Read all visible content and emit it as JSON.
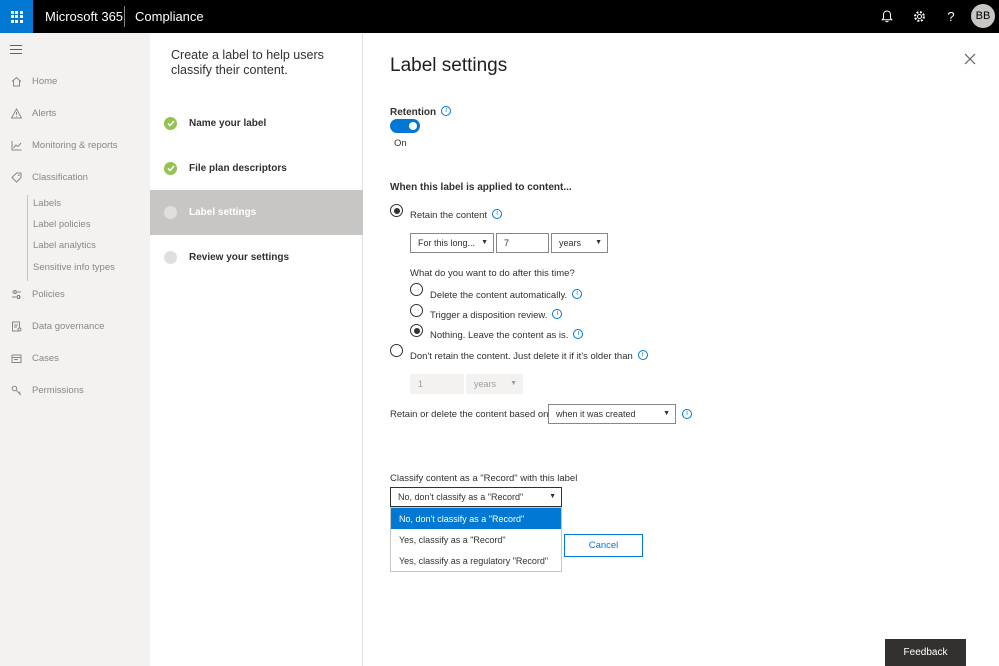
{
  "topbar": {
    "brand": "Microsoft 365",
    "app": "Compliance",
    "avatar": "BB",
    "icons": [
      "bell-icon",
      "gear-icon",
      "help-icon"
    ]
  },
  "nav": {
    "items": [
      {
        "label": "Home",
        "icon": "home-icon"
      },
      {
        "label": "Alerts",
        "icon": "alert-icon"
      },
      {
        "label": "Monitoring & reports",
        "icon": "chart-icon"
      },
      {
        "label": "Classification",
        "icon": "tag-icon"
      },
      {
        "label": "Policies",
        "icon": "sliders-icon"
      },
      {
        "label": "Data governance",
        "icon": "lock-icon"
      },
      {
        "label": "Cases",
        "icon": "cases-icon"
      },
      {
        "label": "Permissions",
        "icon": "key-icon"
      }
    ],
    "subitems": [
      "Labels",
      "Label policies",
      "Label analytics",
      "Sensitive info types"
    ]
  },
  "wizard": {
    "heading": "Create a label to help users classify their content.",
    "steps": [
      "Name your label",
      "File plan descriptors",
      "Label settings",
      "Review your settings"
    ]
  },
  "main": {
    "title": "Label settings",
    "retention_label": "Retention",
    "toggle_state": "On",
    "section_heading": "When this label is applied to content...",
    "retain_label": "Retain the content",
    "retain_period": "For this long...",
    "retain_value": "7",
    "retain_unit": "years",
    "after_question": "What do you want to do after this time?",
    "opt_delete": "Delete the content automatically.",
    "opt_disposition": "Trigger a disposition review.",
    "opt_nothing": "Nothing. Leave the content as is.",
    "dont_retain_label": "Don't retain the content. Just delete it if it's older than",
    "dont_retain_value": "1",
    "dont_retain_unit": "years",
    "based_on_label": "Retain or delete the content based on",
    "based_on_value": "when it was created",
    "record_label": "Classify content as a \"Record\" with this label",
    "record_value": "No, don't classify as a \"Record\"",
    "record_options": [
      "No, don't classify as a \"Record\"",
      "Yes, classify as a \"Record\"",
      "Yes, classify as a regulatory \"Record\""
    ],
    "cancel": "Cancel",
    "feedback": "Feedback"
  },
  "colors": {
    "accent": "#0078d4",
    "check": "#92c353"
  }
}
